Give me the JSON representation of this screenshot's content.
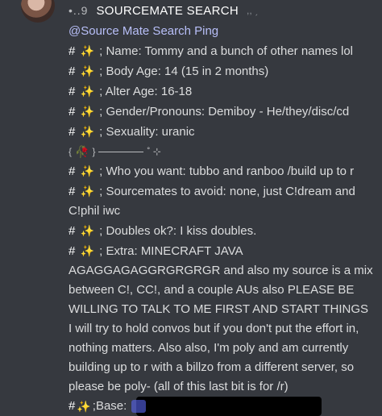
{
  "message": {
    "header_prefix": "•..9",
    "title": "SOURCEMATE SEARCH",
    "title_tail": ",, ˏ",
    "mention": "@Source Mate Search Ping",
    "hash": "#",
    "star_glyph": "✨",
    "sep": ";",
    "lines": {
      "name": "Name: Tommy and a bunch of other names lol",
      "body_age": "Body Age: 14 (15 in 2 months)",
      "alter_age": "Alter Age: 16-18",
      "gender": "Gender/Pronouns: Demiboy - He/they/disc/cd",
      "sexuality": "Sexuality: uranic"
    },
    "divider": {
      "left": "{",
      "rose": "🥀",
      "right": "}",
      "tail": "˚ ⊹"
    },
    "lines2": {
      "who": "Who you want: tubbo and ranboo /build up to r",
      "avoid": "Sourcemates to avoid: none, just C!dream and C!phil iwc",
      "doubles": "Doubles ok?: I kiss doubles.",
      "extra": "Extra: MINECRAFT JAVA AGAGGAGAGGRGRGRGR and also my source is a mix between C!, CC!, and a couple AUs also PLEASE BE WILLING TO TALK TO ME FIRST AND START THINGS I will try to hold convos but if you don't put the effort in, nothing matters. Also also, I'm poly and am currently building up to r with a billzo from a different server, so please be poly- (all of this last bit is for /r)",
      "base": "Base:"
    }
  }
}
